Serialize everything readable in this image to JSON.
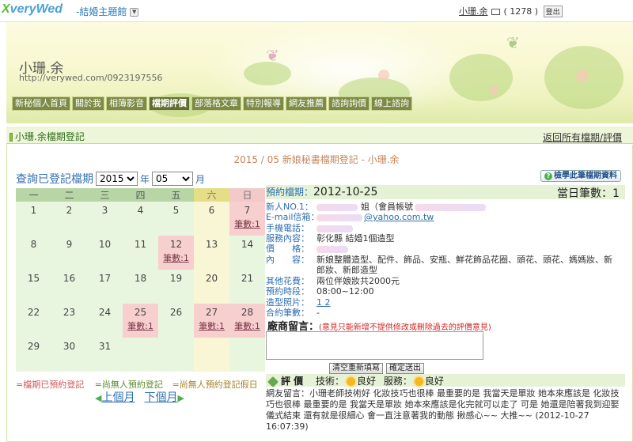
{
  "topbar": {
    "logo_x": "X",
    "logo_text": "veryWed",
    "theme_label": "-結婚主題館",
    "user_name": "小珊.余",
    "mail_count": "( 1278 )",
    "logout_label": "登出"
  },
  "banner": {
    "site_name": "小珊.余",
    "site_url": "http://verywed.com/0923197556"
  },
  "nav": [
    {
      "label": "新秘個人首頁"
    },
    {
      "label": "關於我"
    },
    {
      "label": "相簿影音"
    },
    {
      "label": "檔期評價"
    },
    {
      "label": "部落格文章"
    },
    {
      "label": "特別報導"
    },
    {
      "label": "網友推薦"
    },
    {
      "label": "諮詢詢價"
    },
    {
      "label": "線上諮詢"
    }
  ],
  "section": {
    "title": "小珊.余檔期登記",
    "back_link": "返回所有檔期/評價"
  },
  "subtitle": "2015 / 05 新娘秘書檔期登記 - 小珊.余",
  "query": {
    "label": "查詢已登記檔期",
    "year": "2015",
    "year_unit": "年",
    "month": "05",
    "month_unit": "月"
  },
  "all_button": "檢學此筆檔期資料",
  "calendar": {
    "weekdays": [
      "一",
      "二",
      "三",
      "四",
      "五",
      "六",
      "日"
    ],
    "booked_label": "筆數:1",
    "weeks": [
      [
        {
          "d": "1"
        },
        {
          "d": "2"
        },
        {
          "d": "3"
        },
        {
          "d": "4"
        },
        {
          "d": "5"
        },
        {
          "d": "6"
        },
        {
          "d": "7",
          "b": true
        }
      ],
      [
        {
          "d": "8"
        },
        {
          "d": "9"
        },
        {
          "d": "10"
        },
        {
          "d": "11"
        },
        {
          "d": "12",
          "b": true
        },
        {
          "d": "13"
        },
        {
          "d": "14"
        }
      ],
      [
        {
          "d": "15"
        },
        {
          "d": "16"
        },
        {
          "d": "17"
        },
        {
          "d": "18"
        },
        {
          "d": "19"
        },
        {
          "d": "20"
        },
        {
          "d": "21"
        }
      ],
      [
        {
          "d": "22"
        },
        {
          "d": "23"
        },
        {
          "d": "24"
        },
        {
          "d": "25",
          "b": true
        },
        {
          "d": "26"
        },
        {
          "d": "27",
          "b": true
        },
        {
          "d": "28",
          "b": true
        }
      ],
      [
        {
          "d": "29"
        },
        {
          "d": "30"
        },
        {
          "d": "31"
        },
        {
          "d": ""
        },
        {
          "d": ""
        },
        {
          "d": ""
        },
        {
          "d": ""
        }
      ]
    ]
  },
  "legend": {
    "booked": "=檔期已預約登記",
    "free": "=尚無人預約登記",
    "free_holiday": "=尚無人預約登記假日"
  },
  "pager": {
    "prev": "上個月",
    "next": "下個月"
  },
  "detail": {
    "date_label": "預約檔期：",
    "date_value": "2012-10-25",
    "daycount_label": "當日筆數：",
    "daycount_value": "1",
    "rows": [
      {
        "label": "新人NO.1：",
        "value": "姐（會員帳號"
      },
      {
        "label": "E-mail信箱：",
        "value": "@yahoo.com.tw"
      },
      {
        "label": "手機電話：",
        "value": ""
      },
      {
        "label": "服務內容：",
        "value": "彰化縣 結婚1個造型"
      },
      {
        "label": "價　　格：",
        "value": ""
      },
      {
        "label": "內　　容：",
        "value": "新娘整體造型、配件、飾品、安瓶、鮮花飾品花圈、頭花、頭花、媽媽妝、新"
      },
      {
        "label": "",
        "value": "郎妝、新郎造型"
      },
      {
        "label": "其他花費：",
        "value": "兩位伴娘妝共2000元"
      },
      {
        "label": "預約時段：",
        "value": "08:00~12:00"
      },
      {
        "label": "造型照片：",
        "value": "1  2"
      },
      {
        "label": "合約筆數：",
        "value": "-"
      }
    ],
    "reply_title": "廠商留言：",
    "reply_note": "(意見只能新增不提供修改或刪除過去的評價意見)",
    "btn_reset": "清空重新填寫",
    "btn_submit": "確定送出"
  },
  "evaluation": {
    "title": "評 價",
    "skill_label": "技術：",
    "skill_value": "良好",
    "service_label": "服務：",
    "service_value": "良好",
    "comment": "網友留言：小珊老師技術好 化妝技巧也很棒 最重要的是 我當天是單妝 她本來應該是 化妝技巧也很棒 最重要的是 我當天是單妝 她本來應該是化完就可以走了 可是 她還是陪著我到迎娶儀式結束 還有就是很細心 會一直注意著我的動態 揪感心~~ 大推~~ (2012-10-27 16:07:39)"
  },
  "colors": {
    "nav_bg": "#7c8a46",
    "link_blue": "#2f6eb0",
    "booked_pink": "#f7cfcf",
    "calendar_green": "#e9f6df"
  }
}
